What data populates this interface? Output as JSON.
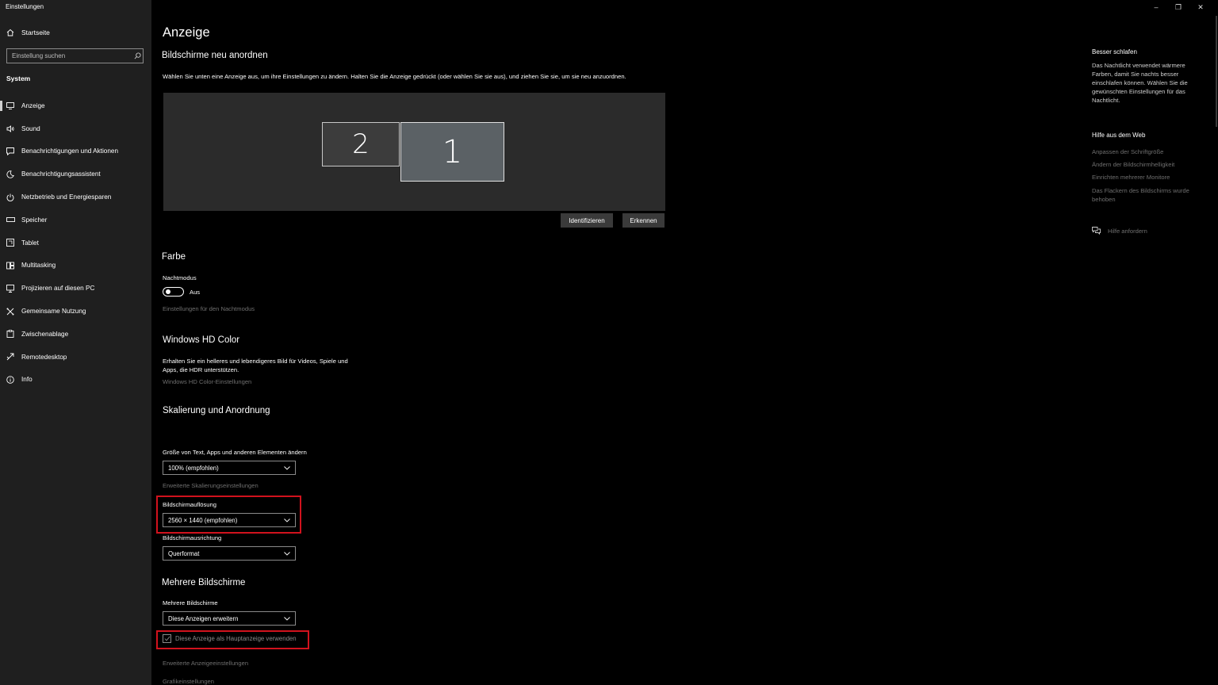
{
  "window": {
    "title": "Einstellungen",
    "controls": {
      "minimize": "–",
      "restore": "❐",
      "close": "✕"
    }
  },
  "sidebar": {
    "home_label": "Startseite",
    "search_placeholder": "Einstellung suchen",
    "section_label": "System",
    "items": [
      {
        "label": "Anzeige",
        "icon": "monitor-icon",
        "active": true
      },
      {
        "label": "Sound",
        "icon": "speaker-icon"
      },
      {
        "label": "Benachrichtigungen und Aktionen",
        "icon": "notification-icon"
      },
      {
        "label": "Benachrichtigungsassistent",
        "icon": "moon-icon"
      },
      {
        "label": "Netzbetrieb und Energiesparen",
        "icon": "power-icon"
      },
      {
        "label": "Speicher",
        "icon": "storage-icon"
      },
      {
        "label": "Tablet",
        "icon": "tablet-icon"
      },
      {
        "label": "Multitasking",
        "icon": "multitasking-icon"
      },
      {
        "label": "Projizieren auf diesen PC",
        "icon": "projection-icon"
      },
      {
        "label": "Gemeinsame Nutzung",
        "icon": "share-icon"
      },
      {
        "label": "Zwischenablage",
        "icon": "clipboard-icon"
      },
      {
        "label": "Remotedesktop",
        "icon": "remote-desktop-icon"
      },
      {
        "label": "Info",
        "icon": "info-icon"
      }
    ]
  },
  "main": {
    "title": "Anzeige",
    "arrange": {
      "heading": "Bildschirme neu anordnen",
      "description": "Wählen Sie unten eine Anzeige aus, um ihre Einstellungen zu ändern. Halten Sie die Anzeige gedrückt (oder wählen Sie sie aus), und ziehen Sie sie, um sie neu anzuordnen.",
      "monitor_2": "2",
      "monitor_1": "1",
      "identify_button": "Identifizieren",
      "detect_button": "Erkennen"
    },
    "color": {
      "heading": "Farbe",
      "night_mode_label": "Nachtmodus",
      "night_mode_state": "Aus",
      "night_mode_settings_link": "Einstellungen für den Nachtmodus"
    },
    "hdr": {
      "heading": "Windows HD Color",
      "description_line1": "Erhalten Sie ein helleres und lebendigeres Bild für Videos, Spiele und",
      "description_line2": "Apps, die HDR unterstützen.",
      "settings_link": "Windows HD Color-Einstellungen"
    },
    "scaling": {
      "heading": "Skalierung und Anordnung",
      "size_label": "Größe von Text, Apps und anderen Elementen ändern",
      "size_value": "100% (empfohlen)",
      "advanced_link": "Erweiterte Skalierungseinstellungen",
      "resolution_label": "Bildschirmauflösung",
      "resolution_value": "2560 × 1440 (empfohlen)",
      "orientation_label": "Bildschirmausrichtung",
      "orientation_value": "Querformat"
    },
    "multi": {
      "heading": "Mehrere Bildschirme",
      "label": "Mehrere Bildschirme",
      "value": "Diese Anzeigen erweitern",
      "main_display_checkbox": "Diese Anzeige als Hauptanzeige verwenden",
      "main_display_checked": true,
      "advanced_display_link": "Erweiterte Anzeigeeinstellungen",
      "graphics_link": "Grafikeinstellungen"
    }
  },
  "right_panel": {
    "sleep_heading": "Besser schlafen",
    "sleep_text": "Das Nachtlicht verwendet wärmere Farben, damit Sie nachts besser einschlafen können. Wählen Sie die gewünschten Einstellungen für das Nachtlicht.",
    "web_help_heading": "Hilfe aus dem Web",
    "links": [
      "Anpassen der Schriftgröße",
      "Ändern der Bildschirmhelligkeit",
      "Einrichten mehrerer Monitore",
      "Das Flackern des Bildschirms wurde behoben"
    ],
    "get_help": "Hilfe anfordern"
  },
  "colors": {
    "highlight": "#d1121d",
    "sidebar_bg": "#1f1f1f",
    "content_bg": "#000000"
  }
}
